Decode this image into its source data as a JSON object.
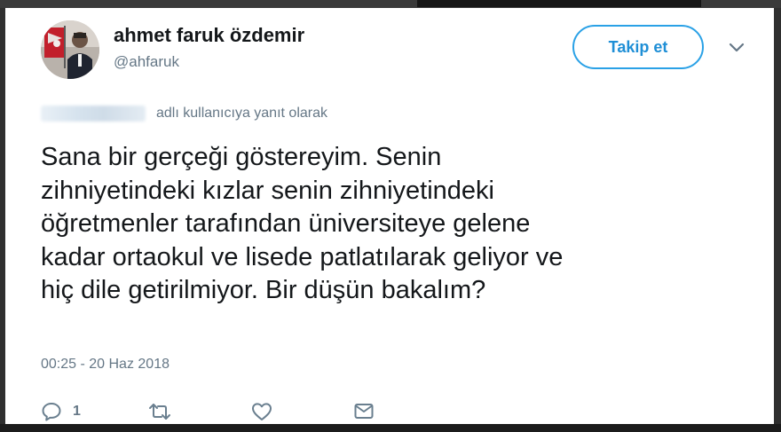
{
  "user": {
    "display_name": "ahmet faruk özdemir",
    "handle": "@ahfaruk"
  },
  "follow_button": {
    "label": "Takip et"
  },
  "reply_context": {
    "label": "adlı kullanıcıya yanıt olarak"
  },
  "tweet": {
    "lines": [
      "Sana bir gerçeği göstereyim. Senin",
      "zihniyetindeki kızlar senin zihniyetindeki",
      "öğretmenler tarafından üniversiteye gelene",
      "kadar ortaokul ve lisede patlatılarak geliyor ve",
      "hiç dile getirilmiyor. Bir düşün bakalım?"
    ],
    "timestamp": "00:25 - 20 Haz 2018"
  },
  "actions": {
    "reply_count": "1",
    "icons": [
      "reply-icon",
      "retweet-icon",
      "like-icon",
      "message-icon"
    ]
  },
  "colors": {
    "accent": "#1f8fd6",
    "text": "#14171a",
    "secondary_text": "#657786",
    "icon": "#6a7f8f"
  }
}
